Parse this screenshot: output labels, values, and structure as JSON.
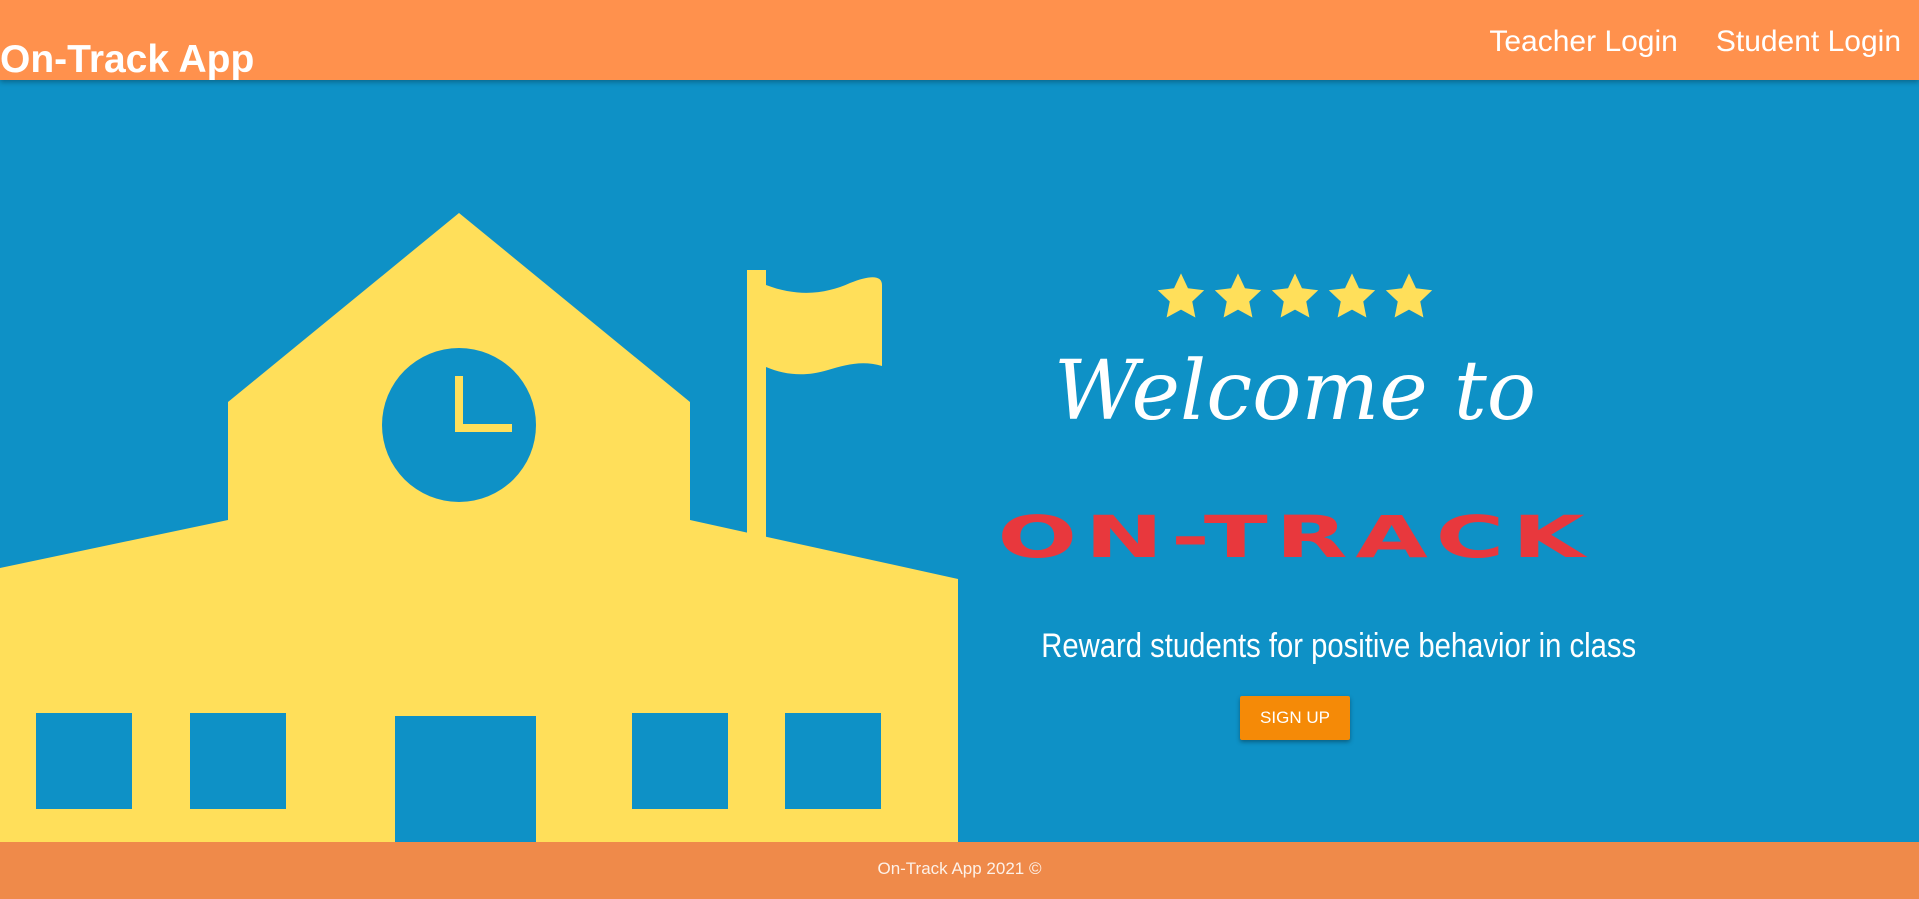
{
  "navbar": {
    "brand": "On-Track App",
    "links": [
      {
        "label": "Teacher Login"
      },
      {
        "label": "Student Login"
      }
    ]
  },
  "hero": {
    "illustration": {
      "icon": "school-building-icon",
      "color": "#ffdf5a"
    },
    "rating": {
      "stars": 5,
      "icon": "star-icon",
      "color": "#ffdf5a"
    },
    "welcome": "Welcome to",
    "logo_text": "ON-TRACK",
    "tagline": "Reward students for positive behavior in class",
    "signup_label": "SIGN UP"
  },
  "footer": {
    "text": "On-Track App 2021 ©"
  },
  "colors": {
    "navbar": "#ff914d",
    "hero_background": "#0e91c6",
    "logo": "#e8383d",
    "button": "#f58a07",
    "footer": "#ef8a4a"
  }
}
